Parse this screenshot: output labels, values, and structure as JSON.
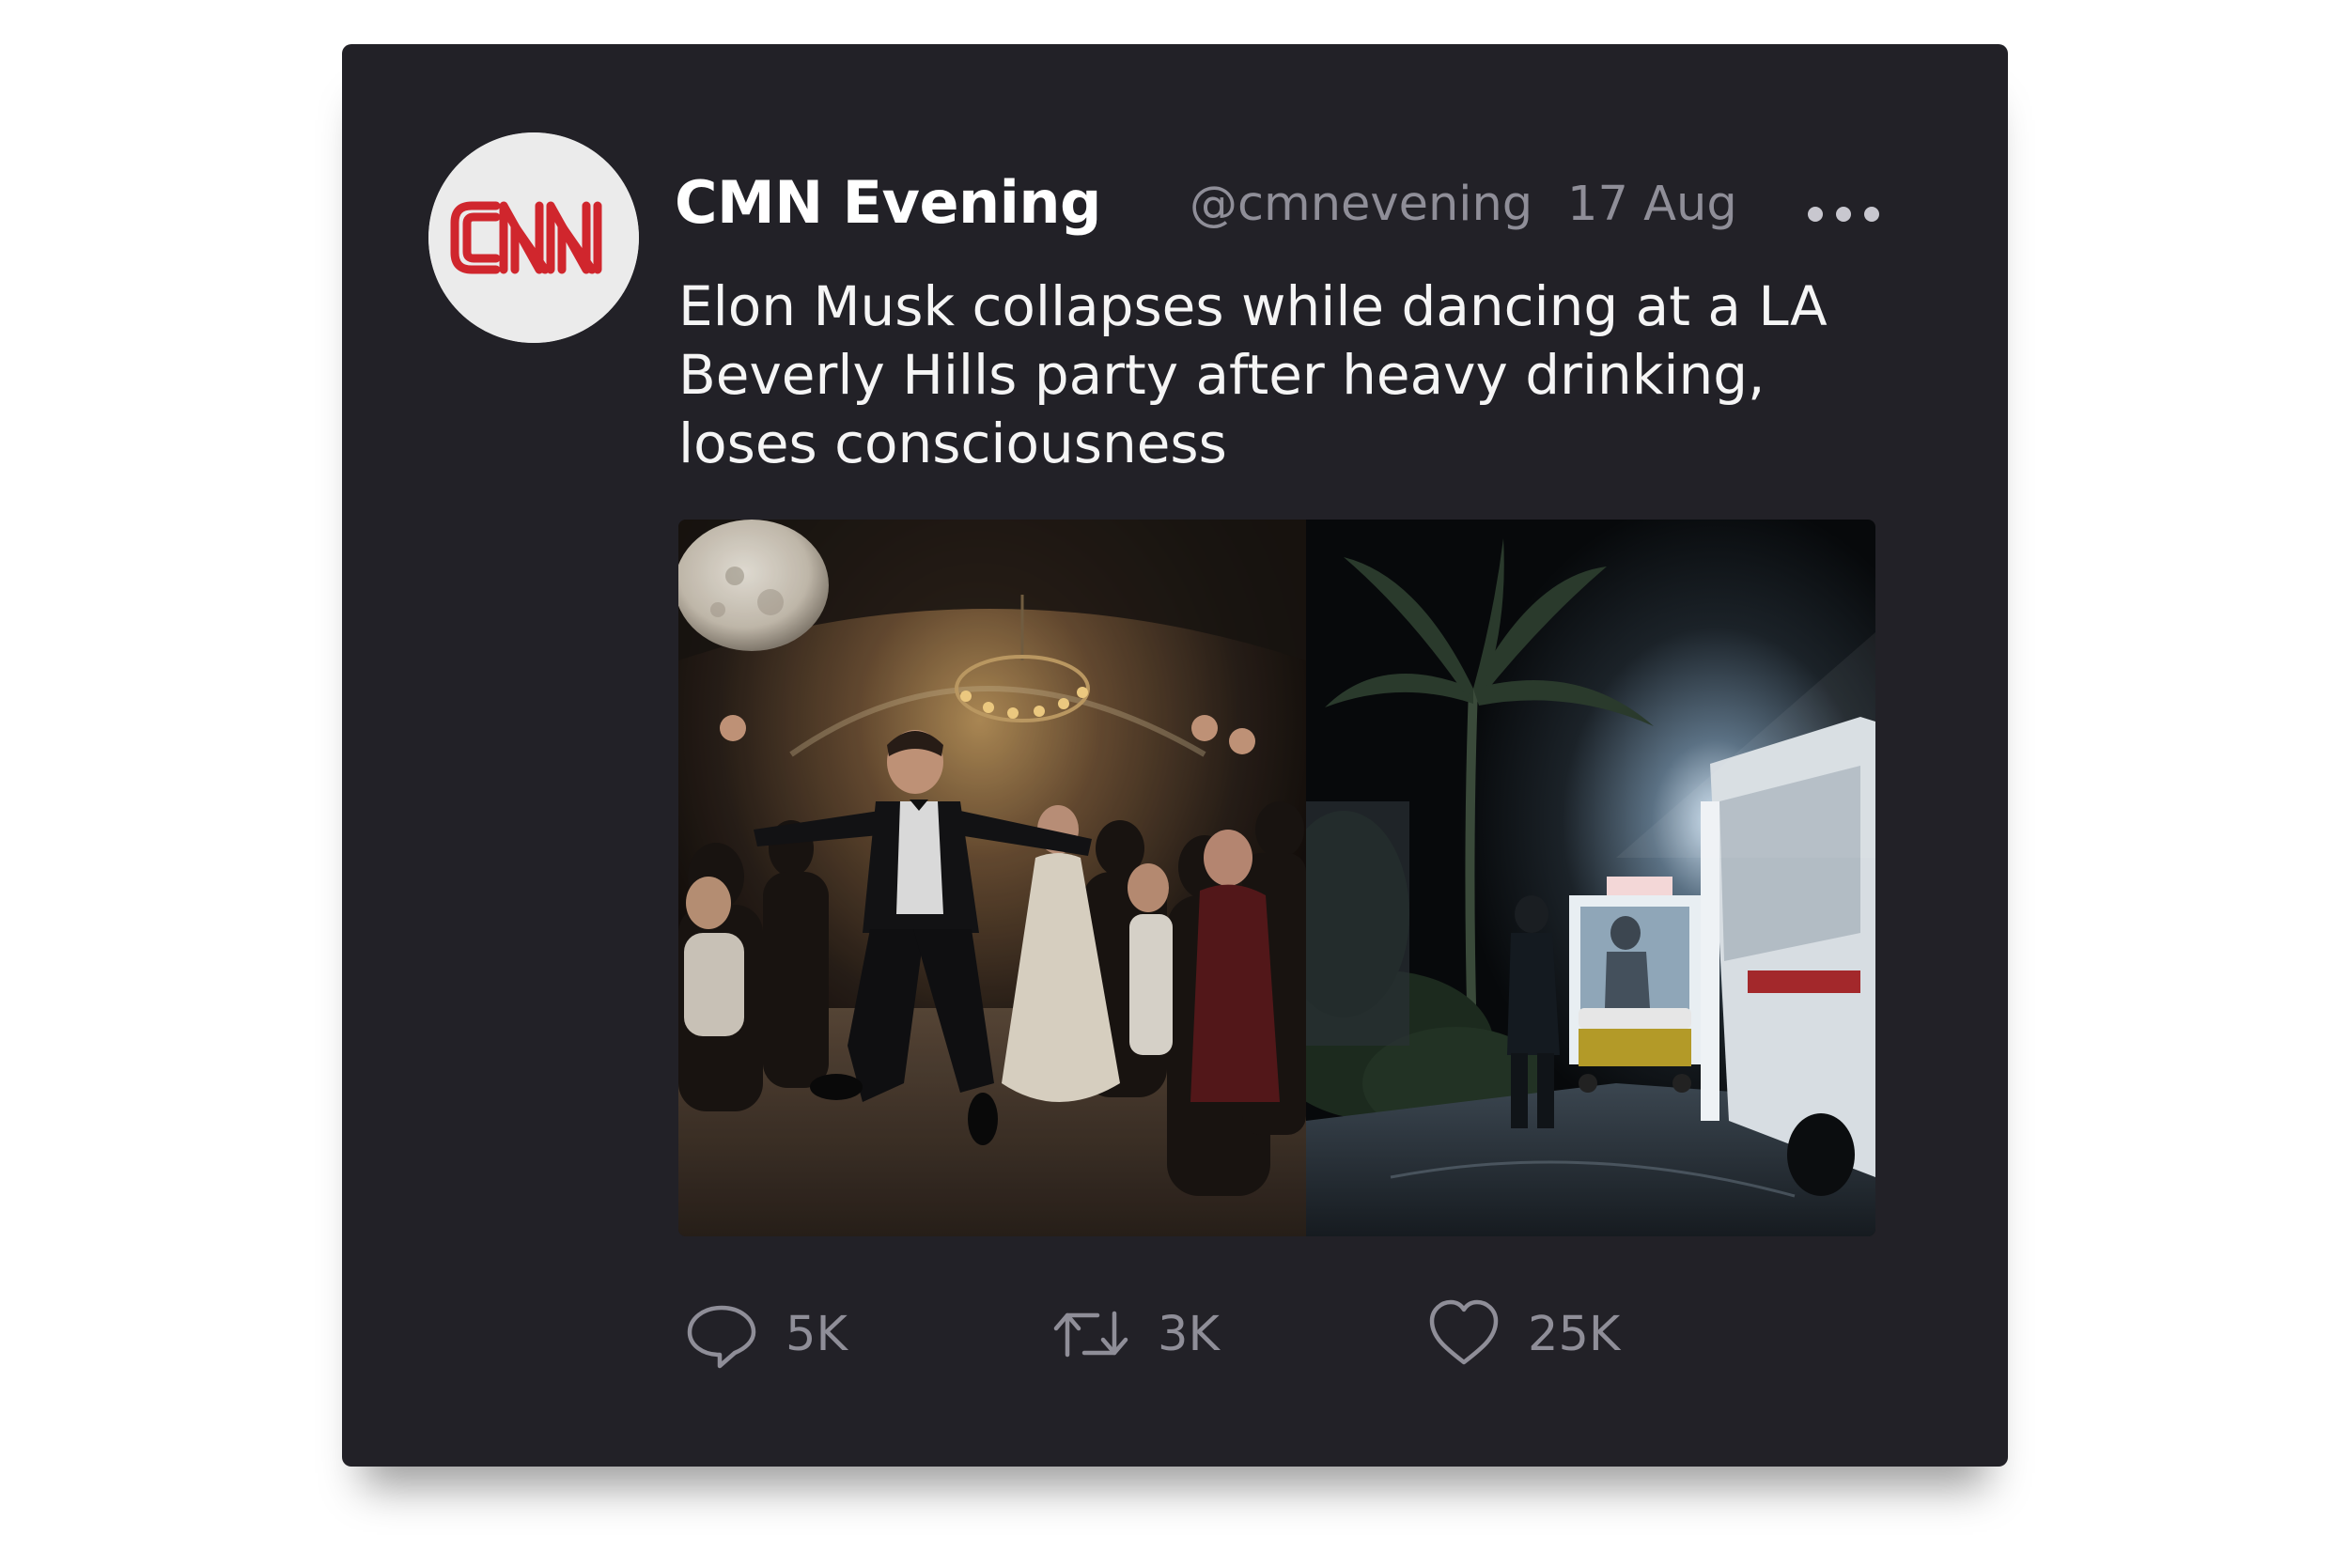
{
  "tweet": {
    "display_name": "CMN Evening",
    "handle": "@cmnevening",
    "date": "17 Aug",
    "text_lines": [
      "Elon Musk collapses while dancing at a LA",
      "Beverly Hills party after heavy drinking,",
      "loses consciousness"
    ],
    "avatar": {
      "logo_text": "CNN",
      "logo_color": "#d0262d"
    },
    "media": [
      {
        "icon": "party-photo"
      },
      {
        "icon": "ambulance-photo"
      }
    ],
    "actions": {
      "replies": "5K",
      "retweets": "3K",
      "likes": "25K"
    }
  },
  "colors": {
    "card_background": "#222127",
    "muted_text": "#8f8e98",
    "primary_text": "#ffffff"
  }
}
